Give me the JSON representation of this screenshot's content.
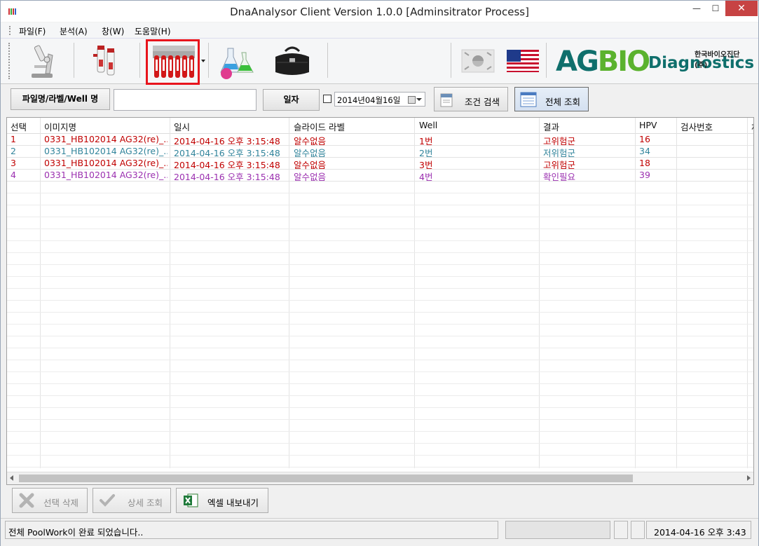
{
  "window": {
    "title": "DnaAnalysor Client Version 1.0.0 [Adminsitrator Process]",
    "min_glyph": "—",
    "max_glyph": "☐",
    "close_glyph": "✕"
  },
  "menu": [
    "파일(F)",
    "분석(A)",
    "창(W)",
    "도움말(H)"
  ],
  "toolbar": {
    "icons": [
      "microscope-icon",
      "sample-tubes-icon",
      "tube-rack-icon",
      "flasks-icon",
      "doctor-bag-icon",
      "korea-flag-icon",
      "usa-flag-icon"
    ],
    "logo": {
      "ag": "AG",
      "bio": "BIO",
      "diagnostics": "Diagnostics",
      "korean": "한국바이오진단(주)"
    }
  },
  "search": {
    "name_button": "파일명/라벨/Well 명",
    "name_value": "",
    "date_button": "일자",
    "date_checked": false,
    "date_value": "2014년04월16일",
    "condition_search": "조건 검색",
    "all_search": "전체 조회"
  },
  "table": {
    "columns": [
      "선택",
      "이미지명",
      "일시",
      "슬라이드 라벨",
      "Well",
      "결과",
      "HPV",
      "검사번호",
      "체"
    ],
    "rows": [
      {
        "color": "#c00000",
        "cells": [
          "1",
          "0331_HB102014 AG32(re)_...",
          "2014-04-16 오후 3:15:48",
          "알수없음",
          "1번",
          "고위험군",
          "16",
          ""
        ]
      },
      {
        "color": "#31849b",
        "cells": [
          "2",
          "0331_HB102014 AG32(re)_...",
          "2014-04-16 오후 3:15:48",
          "알수없음",
          "2번",
          "저위험군",
          "34",
          ""
        ]
      },
      {
        "color": "#c00000",
        "cells": [
          "3",
          "0331_HB102014 AG32(re)_...",
          "2014-04-16 오후 3:15:48",
          "알수없음",
          "3번",
          "고위험군",
          "18",
          ""
        ]
      },
      {
        "color": "#9b30b0",
        "cells": [
          "4",
          "0331_HB102014 AG32(re)_...",
          "2014-04-16 오후 3:15:48",
          "알수없음",
          "4번",
          "확인필요",
          "39",
          ""
        ]
      }
    ]
  },
  "actions": {
    "delete": "선택 삭제",
    "detail": "상세 조회",
    "excel": "엑셀 내보내기"
  },
  "status": {
    "message": "전체 PoolWork이 완료 되었습니다..",
    "datetime": "2014-04-16 오후 3:43"
  }
}
